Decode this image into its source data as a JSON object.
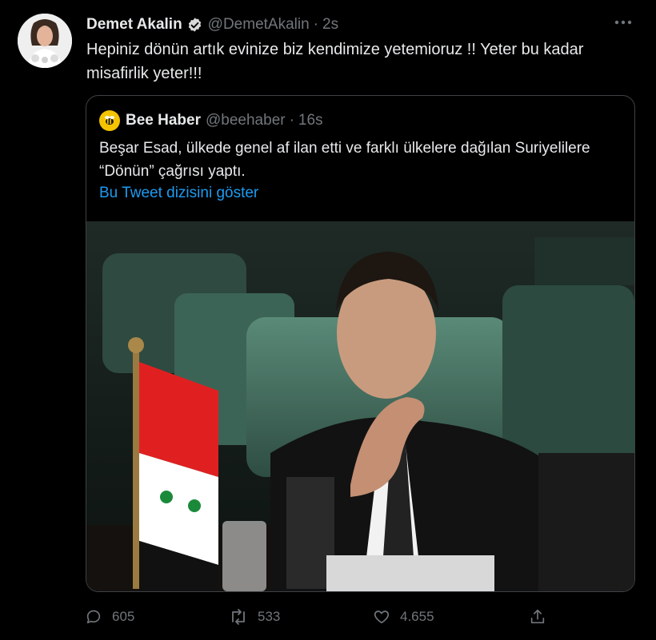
{
  "tweet": {
    "author_name": "Demet Akalin",
    "handle": "@DemetAkalin",
    "separator": "·",
    "time": "2s",
    "text": "Hepiniz dönün artık evinize biz kendimize yetemioruz !! Yeter bu kadar misafirlik yeter!!!",
    "more_icon": "ellipsis-icon",
    "verified_icon": "verified-badge-icon"
  },
  "quote": {
    "author_name": "Bee Haber",
    "handle": "@beehaber",
    "separator": "·",
    "time": "16s",
    "text": "Beşar Esad, ülkede genel af ilan etti ve farklı ülkelere dağılan Suriyelilere “Dönün” çağrısı yaptı.",
    "show_thread": "Bu Tweet dizisini göster",
    "avatar_icon": "bee-icon"
  },
  "actions": {
    "reply": {
      "icon": "reply-icon",
      "count": "605"
    },
    "retweet": {
      "icon": "retweet-icon",
      "count": "533"
    },
    "like": {
      "icon": "heart-icon",
      "count": "4.655"
    },
    "share": {
      "icon": "share-icon"
    }
  },
  "colors": {
    "background": "#000000",
    "text": "#e7e9ea",
    "muted": "#71767b",
    "link": "#1d9bf0",
    "border": "#3e4144",
    "verified_badge": "#d9d9d9",
    "bee_avatar": "#f5c400"
  }
}
